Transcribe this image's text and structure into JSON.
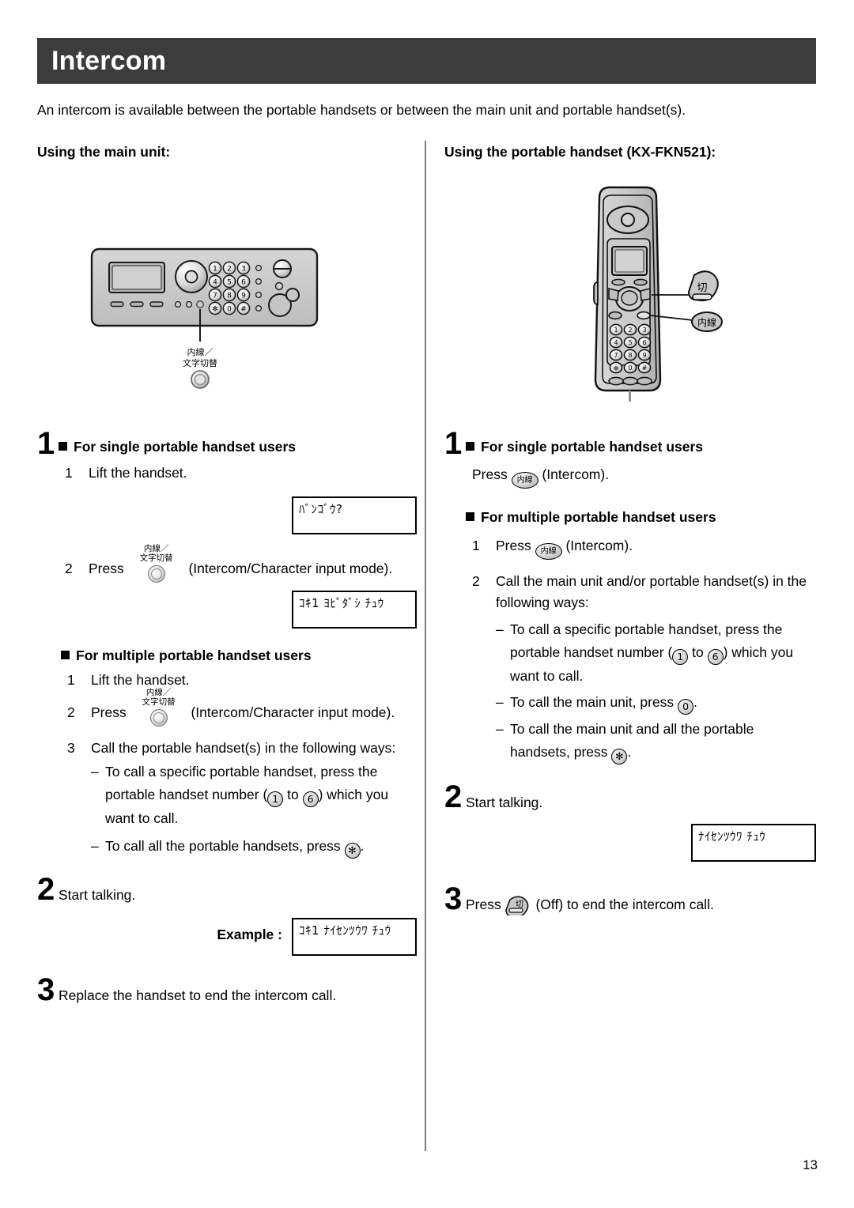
{
  "header": {
    "title": "Intercom"
  },
  "intro": "An intercom is available between the portable handsets or between the main unit and portable handset(s).",
  "page_number": "13",
  "colors": {
    "header_bar": "#3c3c3c",
    "header_text": "#ffffff",
    "divider": "#7d7d7d",
    "body_text": "#000000",
    "device_body": "#c6c6c6"
  },
  "left_column": {
    "heading": "Using the main unit:",
    "illustration": {
      "name": "main-unit-control-panel",
      "callout_label_line1": "内線／",
      "callout_label_line2": "文字切替",
      "keypad": [
        "1",
        "2",
        "3",
        "4",
        "5",
        "6",
        "7",
        "8",
        "9",
        "✻",
        "0",
        "#"
      ]
    },
    "step1": {
      "number": "1",
      "subhead": "For single portable handset users",
      "items": [
        {
          "n": "1",
          "text": "Lift the handset."
        },
        {
          "n": "2",
          "text_before": "Press",
          "button_label_line1": "内線／",
          "button_label_line2": "文字切替",
          "text_after": "(Intercom/Character input mode)."
        }
      ],
      "lcd_1": "ﾊﾞﾝｺﾞｳ?",
      "lcd_2": "ｺｷ1 ﾖﾋﾞﾀﾞｼ ﾁｭｳ"
    },
    "multi": {
      "subhead": "For multiple portable handset users",
      "items": [
        {
          "n": "1",
          "text": "Lift the handset."
        },
        {
          "n": "2",
          "text_before": "Press",
          "button_label_line1": "内線／",
          "button_label_line2": "文字切替",
          "text_after": "(Intercom/Character input mode)."
        },
        {
          "n": "3",
          "text": "Call the portable handset(s) in the following ways:"
        }
      ],
      "dashes": [
        {
          "part1": "To call a specific portable handset, press the portable handset number (",
          "key1": "1",
          "mid": " to ",
          "key2": "6",
          "part2": ") which you want to call."
        },
        {
          "part1": "To call all the portable handsets, press ",
          "key1": "✻",
          "part2": "."
        }
      ]
    },
    "step2": {
      "number": "2",
      "text": "Start talking.",
      "example_label": "Example :",
      "lcd": "ｺｷ1 ﾅｲｾﾝﾂｳﾜ ﾁｭｳ"
    },
    "step3": {
      "number": "3",
      "text": "Replace the handset to end the intercom call."
    }
  },
  "right_column": {
    "heading": "Using the portable handset (KX-FKN521):",
    "illustration": {
      "name": "portable-handset",
      "callout_off": "切",
      "callout_intercom": "内線",
      "keypad": [
        "1",
        "2",
        "3",
        "4",
        "5",
        "6",
        "7",
        "8",
        "9",
        "✻",
        "0",
        "#"
      ]
    },
    "step1": {
      "number": "1",
      "subhead": "For single portable handset users",
      "press_before": "Press",
      "key_label": "内線",
      "press_after": "(Intercom)."
    },
    "multi": {
      "subhead": "For multiple portable handset users",
      "item1": {
        "n": "1",
        "before": "Press",
        "key_label": "内線",
        "after": "(Intercom)."
      },
      "item2": {
        "n": "2",
        "text": "Call the main unit and/or portable handset(s) in the following ways:"
      },
      "dashes": [
        {
          "part1": "To call a specific portable handset, press the portable handset number (",
          "key1": "1",
          "mid": " to ",
          "key2": "6",
          "part2": ") which you want to call."
        },
        {
          "part1": "To call the main unit, press ",
          "key1": "0",
          "part2": "."
        },
        {
          "part1": "To call the main unit and all the portable handsets, press ",
          "key1": "✻",
          "part2": "."
        }
      ]
    },
    "step2": {
      "number": "2",
      "text": "Start talking.",
      "lcd": "ﾅｲｾﾝﾂｳﾜ ﾁｭｳ"
    },
    "step3": {
      "number": "3",
      "before": "Press",
      "key_label": "切",
      "after": "(Off) to end the intercom call."
    }
  }
}
